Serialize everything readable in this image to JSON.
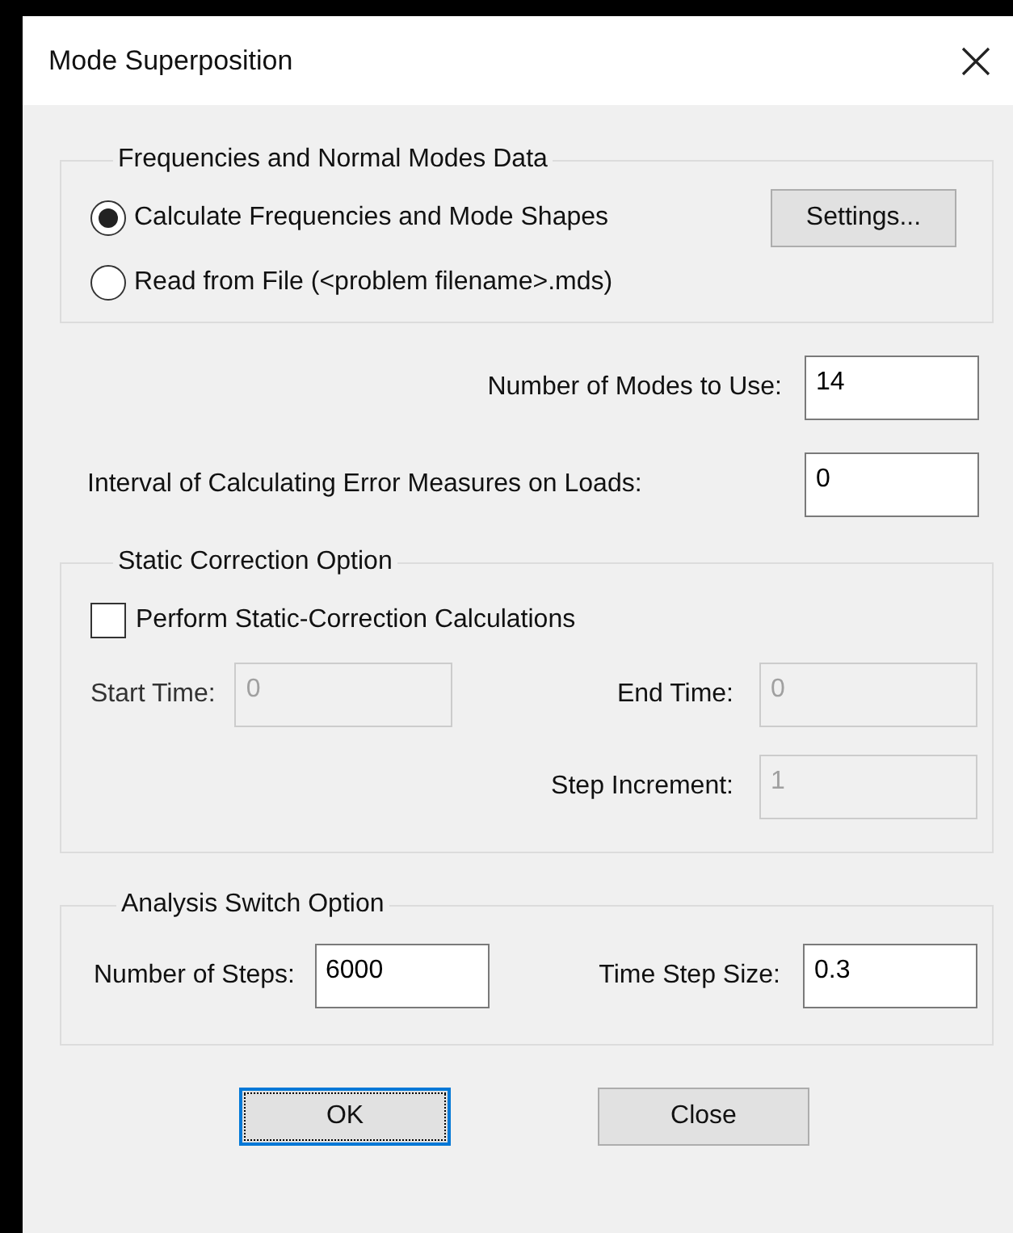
{
  "window": {
    "title": "Mode Superposition"
  },
  "frequencies_group": {
    "title": "Frequencies and Normal Modes Data",
    "options": [
      {
        "label": "Calculate Frequencies and Mode Shapes",
        "selected": true
      },
      {
        "label": "Read from File (<problem filename>.mds)",
        "selected": false
      }
    ],
    "settings_button": "Settings..."
  },
  "modes_field": {
    "label": "Number of Modes to Use:",
    "value": "14"
  },
  "interval_field": {
    "label": "Interval of Calculating Error Measures on Loads:",
    "value": "0"
  },
  "static_correction_group": {
    "title": "Static Correction Option",
    "checkbox": {
      "label": "Perform Static-Correction Calculations",
      "checked": false
    },
    "fields": [
      {
        "label": "Start Time:",
        "value": "0",
        "disabled": true
      },
      {
        "label": "End Time:",
        "value": "0",
        "disabled": true
      },
      {
        "label": "Step Increment:",
        "value": "1",
        "disabled": true
      }
    ]
  },
  "analysis_group": {
    "title": "Analysis Switch Option",
    "fields": [
      {
        "label": "Number of Steps:",
        "value": "6000",
        "disabled": false
      },
      {
        "label": "Time Step Size:",
        "value": "0.3",
        "disabled": false
      }
    ]
  },
  "buttons": [
    {
      "label": "OK",
      "focused": true
    },
    {
      "label": "Close",
      "focused": false
    }
  ]
}
